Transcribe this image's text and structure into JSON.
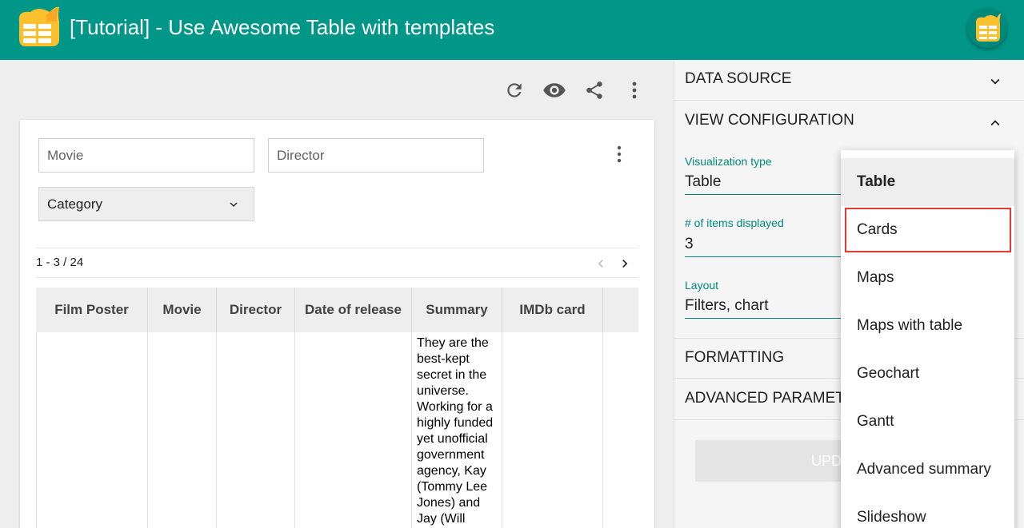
{
  "header": {
    "title": "[Tutorial] - Use Awesome Table with templates",
    "bar_color": "#009688",
    "logo_icon": "awesome-table-flame-logo"
  },
  "toolbar": {
    "icons": [
      "refresh-icon",
      "eye-icon",
      "share-icon",
      "more-vert-icon"
    ]
  },
  "filters": {
    "movie_placeholder": "Movie",
    "director_placeholder": "Director",
    "category_label": "Category"
  },
  "pager": {
    "count": "1 - 3 / 24"
  },
  "table": {
    "columns": [
      "Film Poster",
      "Movie",
      "Director",
      "Date of release",
      "Summary",
      "IMDb card"
    ],
    "rows": [
      {
        "summary": "They are the best-kept secret in the universe. Working for a highly funded yet unofficial government agency, Kay (Tommy Lee Jones) and Jay (Will"
      }
    ]
  },
  "panel": {
    "sections": {
      "data_source": "DATA SOURCE",
      "view_configuration": "VIEW CONFIGURATION",
      "formatting": "FORMATTING",
      "advanced_parameters": "ADVANCED PARAMET"
    },
    "fields": {
      "visualization_type_label": "Visualization type",
      "visualization_type_value": "Table",
      "items_displayed_label": "# of items displayed",
      "items_displayed_value": "3",
      "layout_label": "Layout",
      "layout_value": "Filters, chart"
    },
    "update_button": "UPDA",
    "accent_color": "#00897b"
  },
  "dropdown": {
    "selected": "Table",
    "highlighted": "Cards",
    "options": [
      "Table",
      "Cards",
      "Maps",
      "Maps with table",
      "Geochart",
      "Gantt",
      "Advanced summary",
      "Slideshow"
    ]
  }
}
